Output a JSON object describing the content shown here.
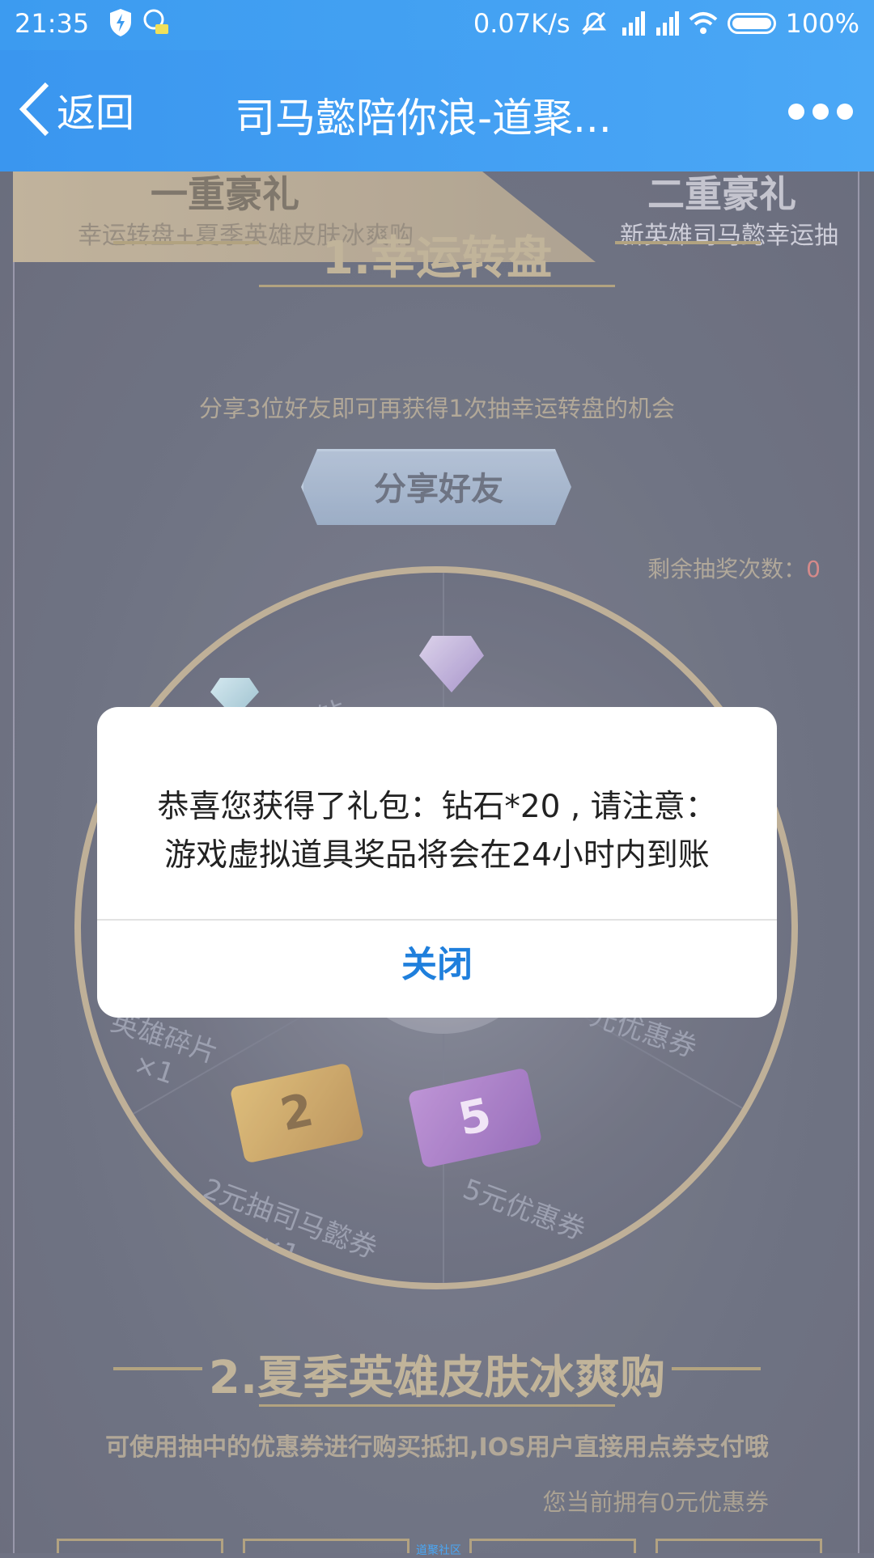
{
  "status_bar": {
    "time": "21:35",
    "network_speed": "0.07K/s",
    "battery": "100%",
    "icons": [
      "shield-bolt-icon",
      "qq-assistant-icon",
      "mute-icon",
      "hd-signal-icon",
      "signal-icon",
      "wifi-icon",
      "battery-icon"
    ]
  },
  "nav": {
    "back_label": "返回",
    "title": "司马懿陪你浪-道聚...",
    "more_icon": "more-dots-icon"
  },
  "tabs": [
    {
      "title": "一重豪礼",
      "subtitle": "幸运转盘+夏季英雄皮肤冰爽购"
    },
    {
      "title": "二重豪礼",
      "subtitle": "新英雄司马懿幸运抽"
    }
  ],
  "section1": {
    "title": "1.幸运转盘",
    "desc": "分享3位好友即可再获得1次抽幸运转盘的机会",
    "share_button": "分享好友",
    "remain_label": "剩余抽奖次数：",
    "remain_count": "0"
  },
  "wheel": {
    "labels": [
      "钻",
      "英雄碎片\n×1",
      "元优惠券",
      "2元抽司马懿券\n×1",
      "5元优惠券"
    ],
    "ticket_2": "2",
    "ticket_5": "5"
  },
  "section2": {
    "title": "2.夏季英雄皮肤冰爽购",
    "desc": "可使用抽中的优惠券进行购买抵扣,IOS用户直接用点券支付哦",
    "coupon_note": "您当前拥有0元优惠券"
  },
  "dialog": {
    "message_line1": "恭喜您获得了礼包：钻石*20 , 请注意：",
    "message_line2": "游戏虚拟道具奖品将会在24小时内到账",
    "close_label": "关闭"
  },
  "footer_small": "道聚社区",
  "colors": {
    "nav_blue": "#4aa7f5",
    "dialog_button": "#1f7fdc",
    "remain_count": "#d07a7a"
  }
}
